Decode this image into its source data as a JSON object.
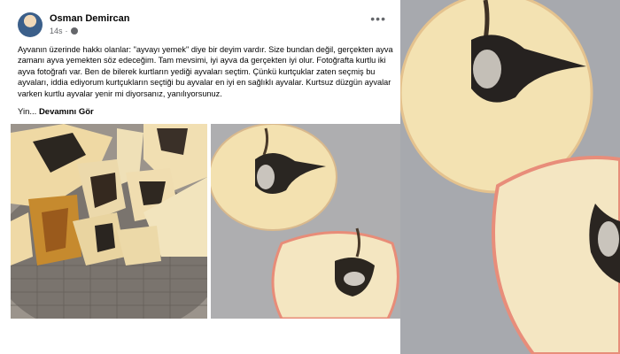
{
  "post": {
    "author": "Osman Demircan",
    "time": "14s",
    "more_label": "•••",
    "body": "Ayvanın üzerinde hakkı olanlar: \"ayvayı yemek\" diye bir deyim vardır. Size bundan değil, gerçekten ayva zamanı ayva yemekten söz edeceğim. Tam mevsimi, iyi ayva da gerçekten iyi olur. Fotoğrafta kurtlu iki ayva fotoğrafı var. Ben de bilerek kurtların yediği ayvaları seçtim. Çünkü kurtçuklar zaten seçmiş bu ayvaları, iddia ediyorum kurtçukların seçtiği bu ayvalar en iyi en sağlıklı ayvalar. Kurtsuz düzgün ayvalar varken kurtlu ayvalar yenir mi diyorsanız, yanılıyorsunuz.",
    "readmore_prefix": "Yin...",
    "readmore_link": "Devamını Gör"
  },
  "colors": {
    "text": "#050505",
    "muted": "#65676b",
    "fruit_flesh": "#f3e3b5",
    "fruit_skin_red": "#e58c78",
    "rot": "#2b2620"
  }
}
